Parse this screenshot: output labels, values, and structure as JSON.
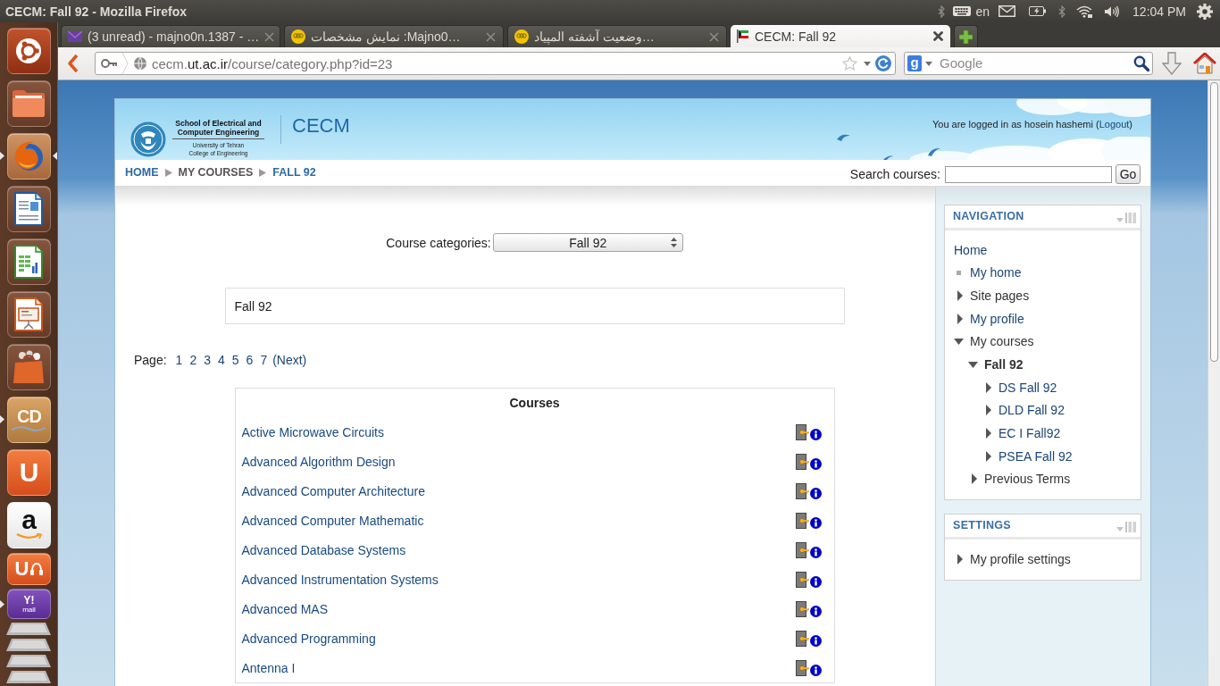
{
  "top_panel": {
    "title": "CECM: Fall 92 - Mozilla Firefox",
    "keyboard_layout": "en",
    "clock": "12:04 PM"
  },
  "launcher": [
    {
      "kind": "ubuntu",
      "running": false,
      "focused": false
    },
    {
      "kind": "files",
      "running": false,
      "focused": false
    },
    {
      "kind": "firefox",
      "running": true,
      "focused": true
    },
    {
      "kind": "writer",
      "running": false,
      "focused": false
    },
    {
      "kind": "calc",
      "running": false,
      "focused": false
    },
    {
      "kind": "impress",
      "running": false,
      "focused": false
    },
    {
      "kind": "software",
      "running": false,
      "focused": false
    },
    {
      "kind": "cd",
      "glyph": "CD",
      "running": true,
      "focused": false
    },
    {
      "kind": "ubuntu_one",
      "glyph": "U",
      "running": false,
      "focused": false
    },
    {
      "kind": "amazon",
      "glyph": "a",
      "running": false,
      "focused": false
    },
    {
      "kind": "music",
      "glyph": "U",
      "running": false,
      "focused": false
    },
    {
      "kind": "mail",
      "glyph": "Y!",
      "caption": "mail",
      "running": true,
      "focused": false
    },
    {
      "kind": "folded",
      "running": false,
      "focused": false
    },
    {
      "kind": "folded",
      "running": false,
      "focused": false
    },
    {
      "kind": "folded",
      "running": false,
      "focused": false
    },
    {
      "kind": "folded",
      "running": false,
      "focused": false
    }
  ],
  "browser": {
    "tabs": [
      {
        "title": "(3 unread) - majno0n.1387 - …",
        "kind": "envelope",
        "selected": false
      },
      {
        "title": "نمایش مشخصات :Majno0…",
        "kind": "badge",
        "selected": false
      },
      {
        "title": "وضعیت آشفته المپیاد…",
        "kind": "badge",
        "selected": false
      },
      {
        "title": "CECM: Fall 92",
        "kind": "flag",
        "selected": true
      }
    ],
    "address": {
      "host": "cecm.",
      "domain": "ut.ac.ir",
      "path": "/course/category.php?id=23"
    },
    "search": {
      "engine": "g",
      "placeholder": "Google"
    }
  },
  "page": {
    "header": {
      "logo": {
        "title_lines": [
          "School of Electrical and",
          "Computer Engineering"
        ],
        "subtitle_lines": [
          "University of Tehran",
          "College of Engineering"
        ]
      },
      "site_name": "CECM",
      "login": {
        "text": "You are logged in as hosein hashemi (",
        "link": "Logout",
        "after": ")"
      }
    },
    "breadcrumb": [
      {
        "label": "HOME",
        "link": true
      },
      {
        "label": "MY COURSES",
        "link": false
      },
      {
        "label": "FALL 92",
        "link": true
      }
    ],
    "course_search": {
      "label": "Search courses:",
      "button": "Go"
    },
    "category_select": {
      "label": "Course categories:",
      "value": "Fall 92"
    },
    "category_description": "Fall 92",
    "pagination": {
      "label": "Page:",
      "pages": [
        "1",
        "2",
        "3",
        "4",
        "5",
        "6",
        "7"
      ],
      "next": "(Next)"
    },
    "courses": {
      "title": "Courses",
      "rows": [
        "Active Microwave Circuits",
        "Advanced Algorithm Design",
        "Advanced Computer Architecture",
        "Advanced Computer Mathematic",
        "Advanced Database Systems",
        "Advanced Instrumentation Systems",
        "Advanced MAS",
        "Advanced Programming",
        "Antenna I"
      ]
    },
    "navigation": {
      "title": "NAVIGATION",
      "items": [
        {
          "label": "Home",
          "kind": "plain",
          "link": true,
          "selected": false
        },
        {
          "label": "My home",
          "kind": "leaf",
          "link": true,
          "selected": false
        },
        {
          "label": "Site pages",
          "kind": "branch",
          "expanded": false,
          "link": false,
          "selected": false
        },
        {
          "label": "My profile",
          "kind": "branch",
          "expanded": false,
          "link": true,
          "selected": false
        },
        {
          "label": "My courses",
          "kind": "branch",
          "expanded": true,
          "link": false,
          "selected": false,
          "children": [
            {
              "label": "Fall 92",
              "kind": "branch",
              "expanded": true,
              "link": false,
              "selected": true,
              "children": [
                {
                  "label": "DS Fall 92",
                  "kind": "branch",
                  "expanded": false,
                  "link": true,
                  "selected": false
                },
                {
                  "label": "DLD Fall 92",
                  "kind": "branch",
                  "expanded": false,
                  "link": true,
                  "selected": false
                },
                {
                  "label": "EC I Fall92",
                  "kind": "branch",
                  "expanded": false,
                  "link": true,
                  "selected": false
                },
                {
                  "label": "PSEA Fall 92",
                  "kind": "branch",
                  "expanded": false,
                  "link": true,
                  "selected": false
                }
              ]
            },
            {
              "label": "Previous Terms",
              "kind": "branch",
              "expanded": false,
              "link": false,
              "selected": false
            }
          ]
        }
      ]
    },
    "settings": {
      "title": "SETTINGS",
      "items": [
        {
          "label": "My profile settings",
          "kind": "branch",
          "expanded": false,
          "link": false,
          "selected": false
        }
      ]
    }
  }
}
